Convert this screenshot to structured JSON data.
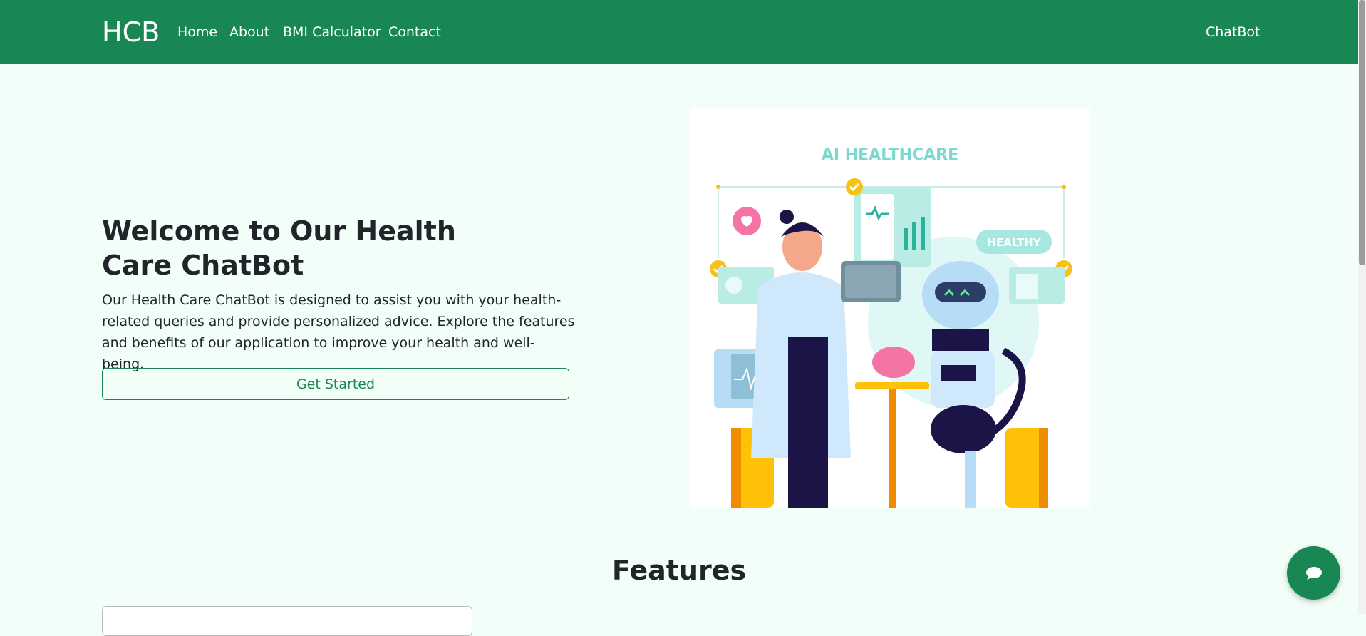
{
  "navbar": {
    "brand": "HCB",
    "links": [
      "Home",
      "About",
      "BMI Calculator",
      "Contact"
    ],
    "right_link": "ChatBot",
    "color": "#198754"
  },
  "hero": {
    "title": "Welcome to Our Health Care ChatBot",
    "description": "Our Health Care ChatBot is designed to assist you with your health-related queries and provide personalized advice. Explore the features and benefits of our application to improve your health and well-being.",
    "button_label": "Get Started",
    "image": {
      "heading": "AI HEALTHCARE",
      "badge": "HEALTHY",
      "icon": "ai-healthcare-illustration"
    }
  },
  "features": {
    "title": "Features"
  },
  "chat_fab": {
    "icon": "chat-bubble-icon"
  }
}
